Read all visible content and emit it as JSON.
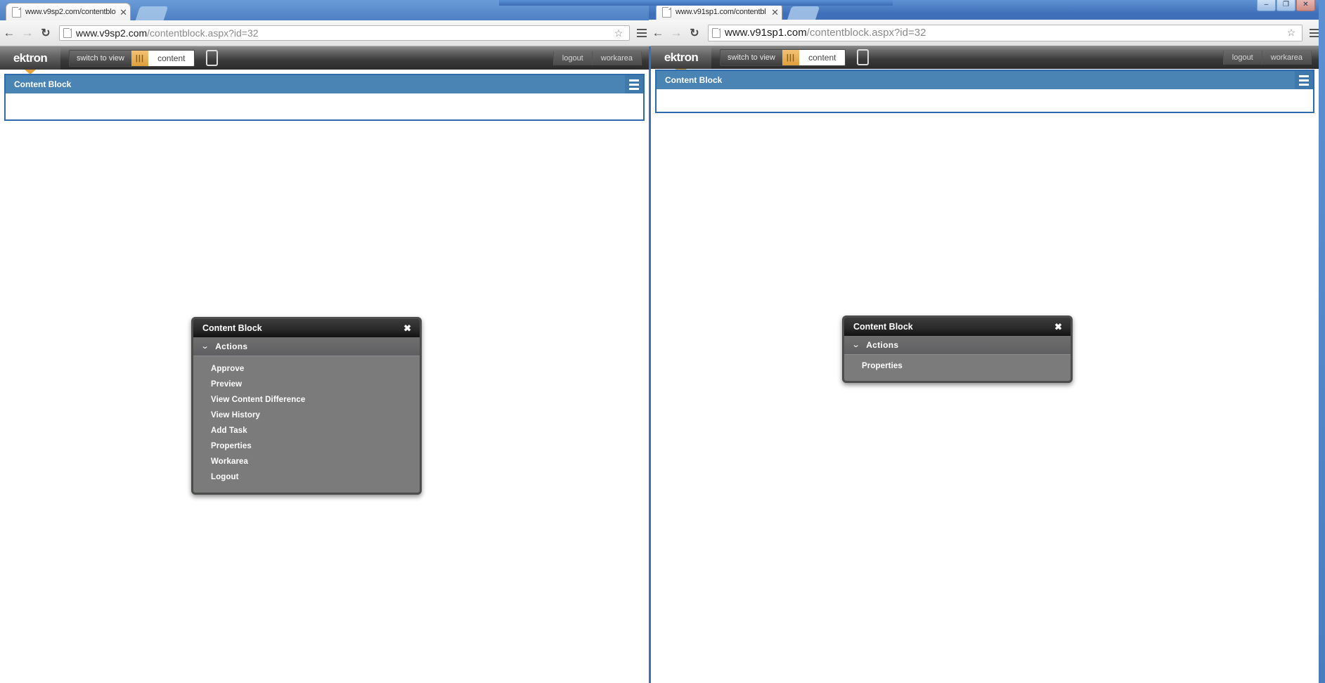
{
  "windows": [
    {
      "id": "left-window",
      "tab": {
        "title": "www.v9sp2.com/contentblo",
        "close": "✕"
      },
      "nav": {
        "back": "←",
        "forward": "→",
        "reload": "↻"
      },
      "omnibox": {
        "url_host": "www.v9sp2.com",
        "url_path": "/contentblock.aspx?id=32",
        "star": "☆"
      },
      "app": {
        "logo": "ektron",
        "switch_to_view": "switch to view",
        "bars_glyph": "|||",
        "content_button": "content",
        "logout": "logout",
        "workarea": "workarea"
      },
      "content_block": {
        "title": "Content Block"
      },
      "dialog": {
        "title": "Content Block",
        "close": "✖",
        "section_label": "Actions",
        "chevron": "⌄",
        "items": [
          "Approve",
          "Preview",
          "View Content Difference",
          "View History",
          "Add Task",
          "Properties",
          "Workarea",
          "Logout"
        ]
      }
    },
    {
      "id": "right-window",
      "window_buttons": {
        "minimize": "–",
        "maximize": "❐",
        "close": "✕"
      },
      "tab": {
        "title": "www.v91sp1.com/contentbl",
        "close": "✕"
      },
      "nav": {
        "back": "←",
        "forward": "→",
        "reload": "↻"
      },
      "omnibox": {
        "url_host": "www.v91sp1.com",
        "url_path": "/contentblock.aspx?id=32",
        "star": "☆"
      },
      "app": {
        "logo": "ektron",
        "switch_to_view": "switch to view",
        "bars_glyph": "|||",
        "content_button": "content",
        "logout": "logout",
        "workarea": "workarea"
      },
      "content_block": {
        "title": "Content Block"
      },
      "dialog": {
        "title": "Content Block",
        "close": "✖",
        "section_label": "Actions",
        "chevron": "⌄",
        "items": [
          "Properties"
        ]
      }
    }
  ],
  "colors": {
    "chrome_blue": "#4d7fc4",
    "panel_blue": "#4a84b5",
    "panel_border": "#2f6aad",
    "accent_orange": "#e3a23b",
    "dialog_body": "#7b7b7b",
    "dialog_title": "#1b1b1b"
  }
}
